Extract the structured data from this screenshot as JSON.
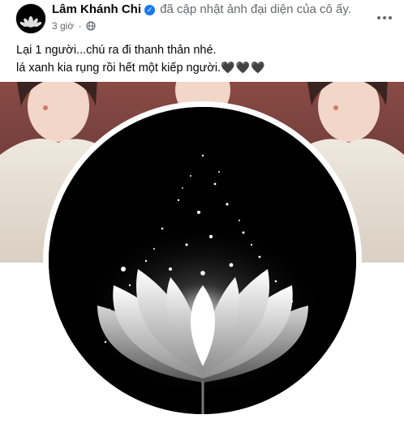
{
  "post": {
    "author": "Lâm Khánh Chi",
    "action_text": "đã cập nhật ảnh đại diện của cô ấy.",
    "time": "3 giờ",
    "separator": "·",
    "verified_icon": "verified-badge-icon",
    "privacy_icon": "globe-icon",
    "more_icon": "more-options-icon",
    "caption_line1": "Lại 1 người...chú ra đi thanh thản nhé.",
    "caption_line2": "lá xanh kia rụng rồi hết một kiếp người.",
    "caption_hearts": "🖤🖤🖤"
  },
  "media": {
    "cover_description_icon": "cover-photo",
    "profile_photo_icon": "white-lotus-image"
  },
  "colors": {
    "verified": "#1877f2",
    "meta_text": "#65676b",
    "profile_bg": "#000000"
  }
}
